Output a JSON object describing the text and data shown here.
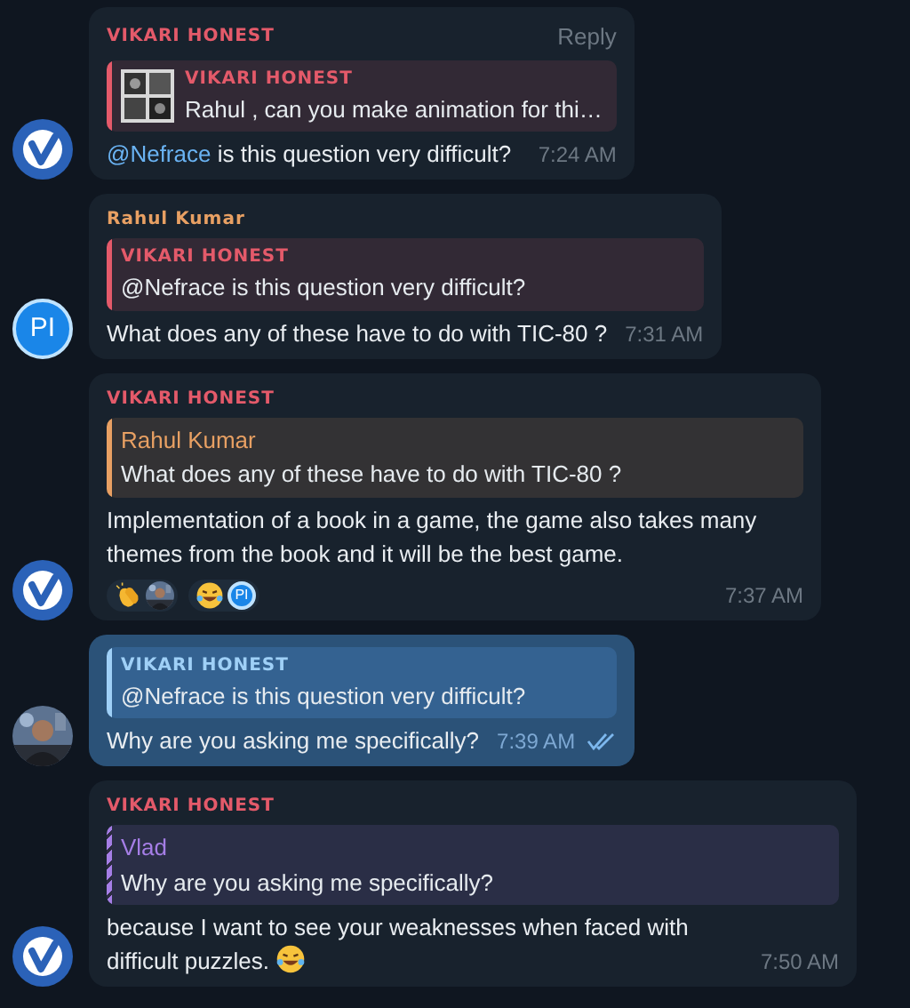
{
  "messages": [
    {
      "avatar": {
        "kind": "v-logo"
      },
      "sender": "VIKARI HONEST",
      "color": "#e45a6a",
      "action": "Reply",
      "outgoing": false,
      "reply": {
        "sender": "VIKARI HONEST",
        "color": "#e45a6a",
        "text": "Rahul , can you make animation for thi…",
        "thumbnail": true,
        "kind": "solid"
      },
      "mention": "@Nefrace",
      "text": " is this question very difficult?",
      "time": "7:24 AM"
    },
    {
      "avatar": {
        "kind": "text-logo",
        "text": "PI"
      },
      "sender": "Rahul Kumar",
      "color": "#e8a063",
      "outgoing": false,
      "reply": {
        "sender": "VIKARI HONEST",
        "color": "#e45a6a",
        "text": "@Nefrace is this question very difficult?",
        "thumbnail": false,
        "kind": "solid"
      },
      "text": "What does any of these have to do with TIC-80 ?",
      "time": "7:31 AM"
    },
    {
      "avatar": {
        "kind": "v-logo"
      },
      "sender": "VIKARI HONEST",
      "color": "#e45a6a",
      "outgoing": false,
      "reply": {
        "sender": "Rahul Kumar",
        "color": "#e8a063",
        "text": "What does any of these have to do with TIC-80 ?",
        "thumbnail": false,
        "kind": "solid"
      },
      "text": "Implementation of a book in a game, the game also takes many themes from the book and it will be the best game.",
      "reactions": [
        {
          "kind": "clap"
        },
        {
          "kind": "laugh",
          "reactor": {
            "kind": "text-logo",
            "text": "PI"
          }
        }
      ],
      "time": "7:37 AM"
    },
    {
      "outgoing": true,
      "reply": {
        "sender": "VIKARI HONEST",
        "color": "#9fd0f7",
        "text": "@Nefrace is this question very difficult?",
        "thumbnail": false,
        "kind": "solid"
      },
      "text": "Why are you asking me specifically?",
      "time": "7:39 AM",
      "read": true
    },
    {
      "avatar": {
        "kind": "v-logo"
      },
      "sender": "VIKARI HONEST",
      "color": "#e45a6a",
      "outgoing": false,
      "reply": {
        "sender": "Vlad",
        "color": "#a57ee6",
        "text": "Why are you asking me specifically?",
        "thumbnail": false,
        "kind": "striped"
      },
      "text": "because I want to see your weaknesses when faced with difficult puzzles.",
      "trailing_emoji": {
        "kind": "laugh"
      },
      "time": "7:50 AM"
    }
  ]
}
